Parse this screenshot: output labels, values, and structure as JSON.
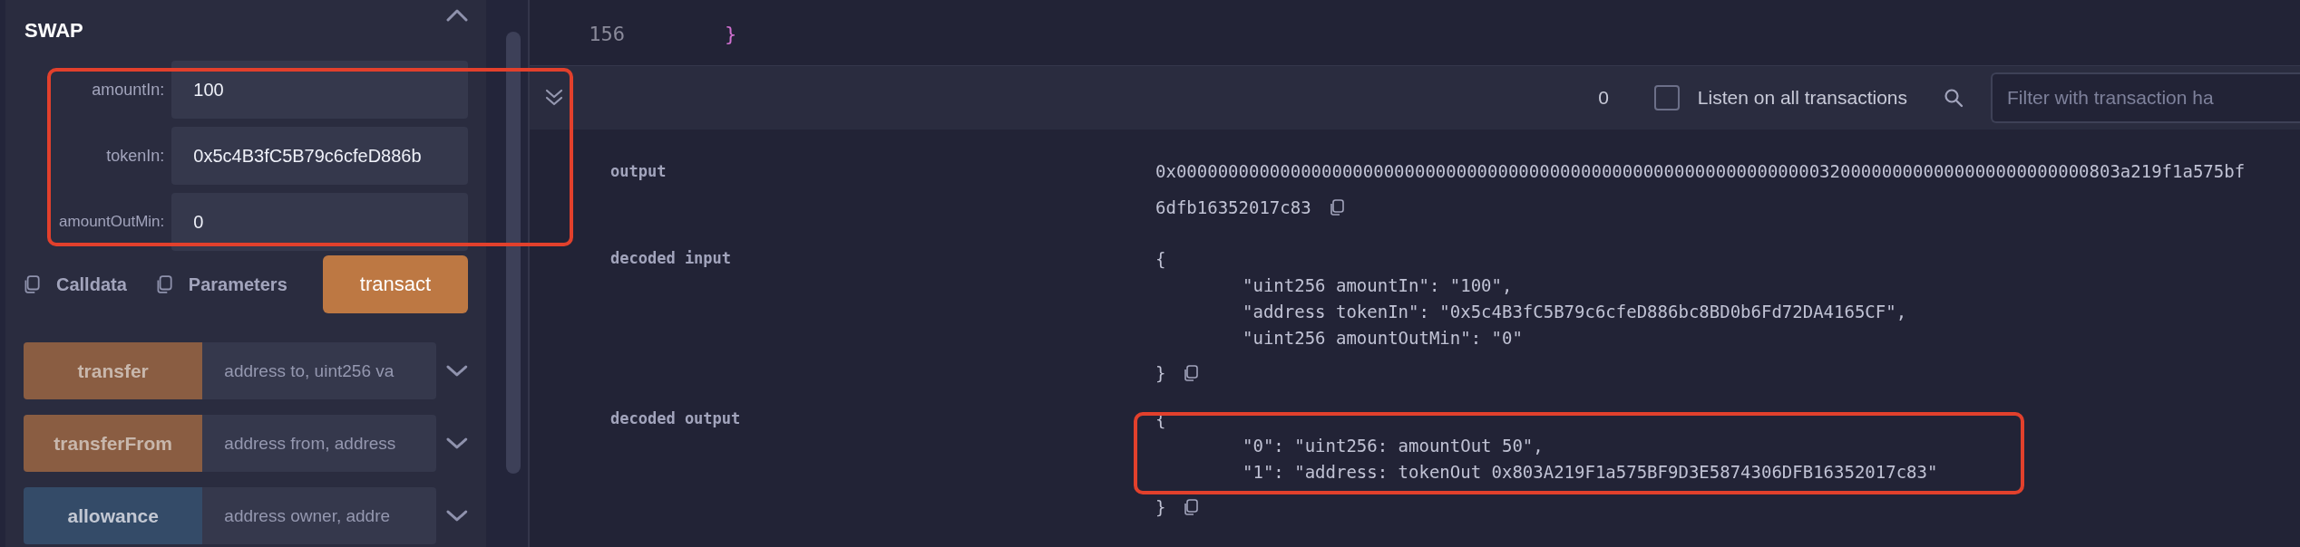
{
  "function_panel": {
    "title": "SWAP",
    "highlighted": true,
    "params": [
      {
        "label": "amountIn:",
        "value": "100"
      },
      {
        "label": "tokenIn:",
        "value": "0x5c4B3fC5B79c6cfeD886b"
      },
      {
        "label": "amountOutMin:",
        "value": "0"
      }
    ],
    "copy_actions": [
      {
        "label": "Calldata"
      },
      {
        "label": "Parameters"
      }
    ],
    "submit": "transact",
    "functions": [
      {
        "name": "transfer",
        "placeholder": "address to, uint256 va",
        "kind": "write"
      },
      {
        "name": "transferFrom",
        "placeholder": "address from, address",
        "kind": "write"
      },
      {
        "name": "allowance",
        "placeholder": "address owner, addre",
        "kind": "call"
      }
    ]
  },
  "editor": {
    "lines": [
      {
        "number": "156",
        "tokens": [
          {
            "text": "}",
            "kind": "brace2"
          }
        ]
      }
    ]
  },
  "terminal": {
    "count": "0",
    "listen": {
      "label": "Listen on all transactions",
      "checked": false
    },
    "filter": {
      "placeholder": "Filter with transaction ha"
    },
    "rows": [
      {
        "label": "output",
        "lines": [
          "0x0000000000000000000000000000000000000000000000000000000000000032000000000000000000000000803a219f1a575bf",
          "6dfb16352017c83"
        ]
      },
      {
        "label": "decoded input",
        "open": "{",
        "entries": [
          "\"uint256 amountIn\": \"100\",",
          "\"address tokenIn\": \"0x5c4B3fC5B79c6cfeD886bc8BD0b6Fd72DA4165CF\",",
          "\"uint256 amountOutMin\": \"0\""
        ],
        "close": "}"
      },
      {
        "label": "decoded output",
        "highlighted": true,
        "open": "{",
        "entries": [
          "\"0\": \"uint256: amountOut 50\",",
          "\"1\": \"address: tokenOut 0x803A219F1a575BF9D3E5874306DFB16352017c83\""
        ],
        "close": "}"
      }
    ]
  }
}
